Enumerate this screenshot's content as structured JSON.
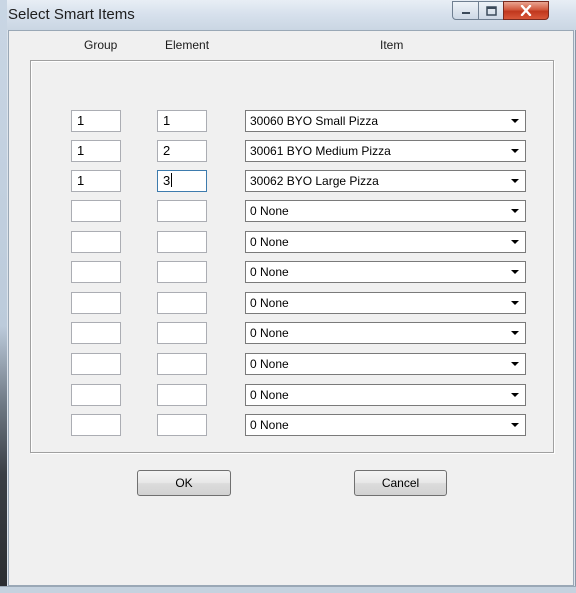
{
  "window": {
    "title": "Select Smart Items"
  },
  "columns": {
    "group": "Group",
    "element": "Element",
    "item": "Item"
  },
  "rows": [
    {
      "group": "1",
      "element": "1",
      "item": "30060 BYO Small Pizza"
    },
    {
      "group": "1",
      "element": "2",
      "item": "30061 BYO Medium Pizza"
    },
    {
      "group": "1",
      "element": "3",
      "item": "30062 BYO Large Pizza"
    },
    {
      "group": "",
      "element": "",
      "item": "0 None"
    },
    {
      "group": "",
      "element": "",
      "item": "0 None"
    },
    {
      "group": "",
      "element": "",
      "item": "0 None"
    },
    {
      "group": "",
      "element": "",
      "item": "0 None"
    },
    {
      "group": "",
      "element": "",
      "item": "0 None"
    },
    {
      "group": "",
      "element": "",
      "item": "0 None"
    },
    {
      "group": "",
      "element": "",
      "item": "0 None"
    },
    {
      "group": "",
      "element": "",
      "item": "0 None"
    }
  ],
  "focused_field": "rows.2.element",
  "buttons": {
    "ok": "OK",
    "cancel": "Cancel"
  },
  "icons": {
    "minimize": "minimize-icon",
    "maximize": "maximize-icon",
    "close": "close-icon",
    "dropdown": "chevron-down-icon"
  },
  "colors": {
    "close_button": "#c9432a",
    "dialog_background": "#f0f0f0",
    "titlebar": "#d6e0ec"
  }
}
